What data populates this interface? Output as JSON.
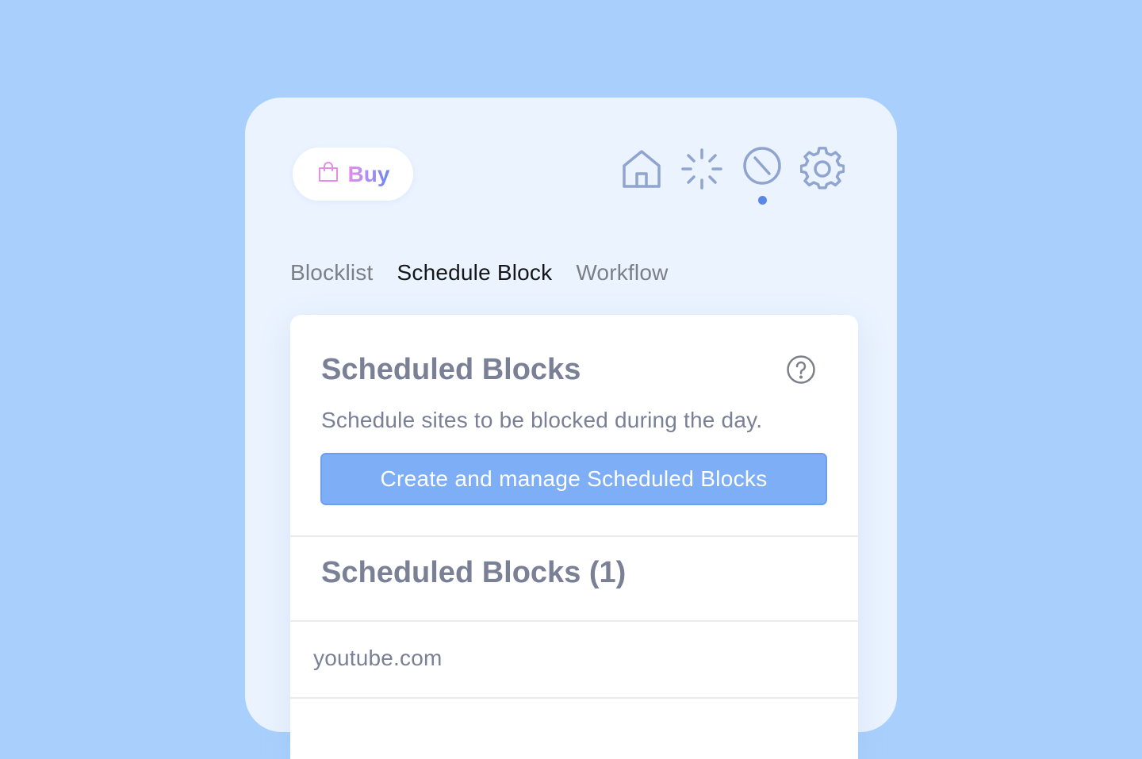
{
  "header": {
    "buy_label": "Buy",
    "nav": [
      {
        "name": "home",
        "icon": "home-icon"
      },
      {
        "name": "focus",
        "icon": "loader-icon"
      },
      {
        "name": "block",
        "icon": "block-icon",
        "active": true
      },
      {
        "name": "settings",
        "icon": "gear-icon"
      }
    ]
  },
  "tabs": [
    {
      "label": "Blocklist",
      "active": false
    },
    {
      "label": "Schedule Block",
      "active": true
    },
    {
      "label": "Workflow",
      "active": false
    }
  ],
  "card": {
    "title": "Scheduled Blocks",
    "description": "Schedule sites to be blocked during the day.",
    "button_label": "Create and manage Scheduled Blocks",
    "list_title": "Scheduled Blocks (1)",
    "items": [
      {
        "label": "youtube.com"
      }
    ]
  },
  "colors": {
    "background": "#a9d0fd",
    "panel": "#eaf3fe",
    "accent": "#7eaef6",
    "active_dot": "#5a86ea",
    "icon": "#8fa4cf"
  }
}
